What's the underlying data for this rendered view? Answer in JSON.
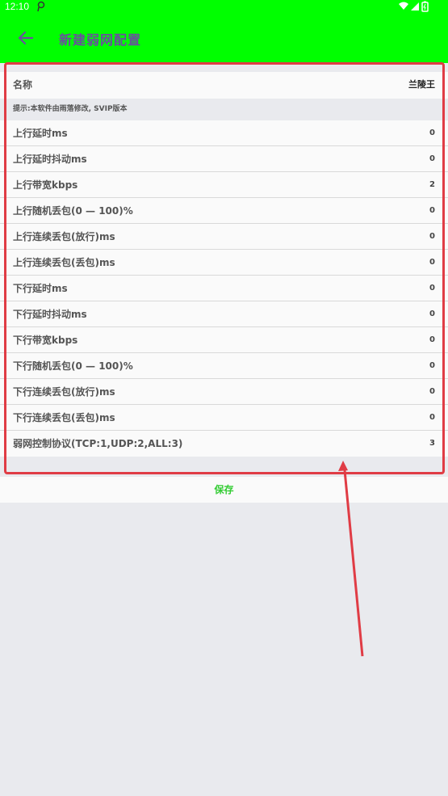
{
  "status_bar": {
    "time": "12:10"
  },
  "app_bar": {
    "title": "新建弱网配置"
  },
  "name_row": {
    "label": "名称",
    "value": "兰陵王"
  },
  "tip": "提示:本软件由雨落修改, SVIP版本",
  "rows": [
    {
      "label": "上行延时ms",
      "value": "0"
    },
    {
      "label": "上行延时抖动ms",
      "value": "0"
    },
    {
      "label": "上行带宽kbps",
      "value": "2"
    },
    {
      "label": "上行随机丢包(0 — 100)%",
      "value": "0"
    },
    {
      "label": "上行连续丢包(放行)ms",
      "value": "0"
    },
    {
      "label": "上行连续丢包(丢包)ms",
      "value": "0"
    },
    {
      "label": "下行延时ms",
      "value": "0"
    },
    {
      "label": "下行延时抖动ms",
      "value": "0"
    },
    {
      "label": "下行带宽kbps",
      "value": "0"
    },
    {
      "label": "下行随机丢包(0 — 100)%",
      "value": "0"
    },
    {
      "label": "下行连续丢包(放行)ms",
      "value": "0"
    },
    {
      "label": "下行连续丢包(丢包)ms",
      "value": "0"
    },
    {
      "label": "弱网控制协议(TCP:1,UDP:2,ALL:3)",
      "value": "3"
    }
  ],
  "save_label": "保存",
  "icons": {
    "back": "arrow-back-icon",
    "notification": "notification-icon",
    "wifi": "wifi-icon",
    "signal": "signal-icon",
    "battery": "battery-icon"
  },
  "colors": {
    "app_bar": "#00ff00",
    "title": "#6a4f9e",
    "save": "#33cc33",
    "annotation": "#e03c45"
  }
}
